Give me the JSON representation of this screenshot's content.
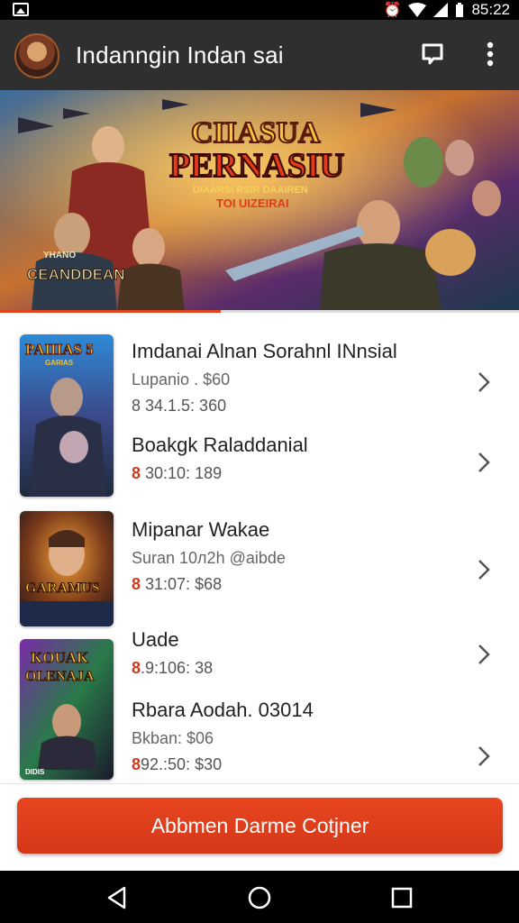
{
  "status_bar": {
    "time": "85:22",
    "icons": [
      "image-icon",
      "alarm-icon",
      "wifi-icon",
      "signal-icon",
      "battery-icon"
    ]
  },
  "app_bar": {
    "title": "Indanngin Indan sai",
    "actions": [
      "chat-icon",
      "more-vert-icon"
    ]
  },
  "banner": {
    "headline_line1": "CIIASUA",
    "headline_line2": "PERNASIU",
    "tagline_line1": "DIAARSI RSIR DAAIREN",
    "tagline_line2": "TOI UIZEIRAI",
    "badge_top": "YHANO",
    "badge": "CEANDDEAN"
  },
  "items": [
    {
      "title": "Imdanai Alnan Sorahnl INnsial",
      "subtitle": "Lupanio . $60",
      "price": "8 34.1.5: 360",
      "cover_text_top": "PAIIIAS 5",
      "cover_text_sub": "GARIAS"
    },
    {
      "title": "Boakgk Raladdanial",
      "price_mark": "8",
      "price": " 30:10: 189"
    },
    {
      "title": "Mipanar Wakae",
      "subtitle": "Suran 10л2h  @aibde",
      "price_mark": "8",
      "price": " 31:07: $68",
      "cover_text": "GARAMUS"
    },
    {
      "title": "Uade",
      "price_mark": "8",
      "price": ".9:106: 38",
      "cover_text_top": "KOUAK",
      "cover_text_mid": "OLENAJA",
      "cover_text_bottom": "DIDIS"
    },
    {
      "title": "Rbara Aodah. 03014",
      "subtitle": "Bkban: $06",
      "price_mark": "8",
      "price": "92.:50: $30"
    }
  ],
  "cta": {
    "label": "Abbmen Darme Cotjner"
  },
  "nav": [
    "back-icon",
    "home-icon",
    "recents-icon"
  ],
  "colors": {
    "app_bar": "#2f2f2f",
    "accent": "#e0441b",
    "price_mark": "#d23a1c"
  }
}
